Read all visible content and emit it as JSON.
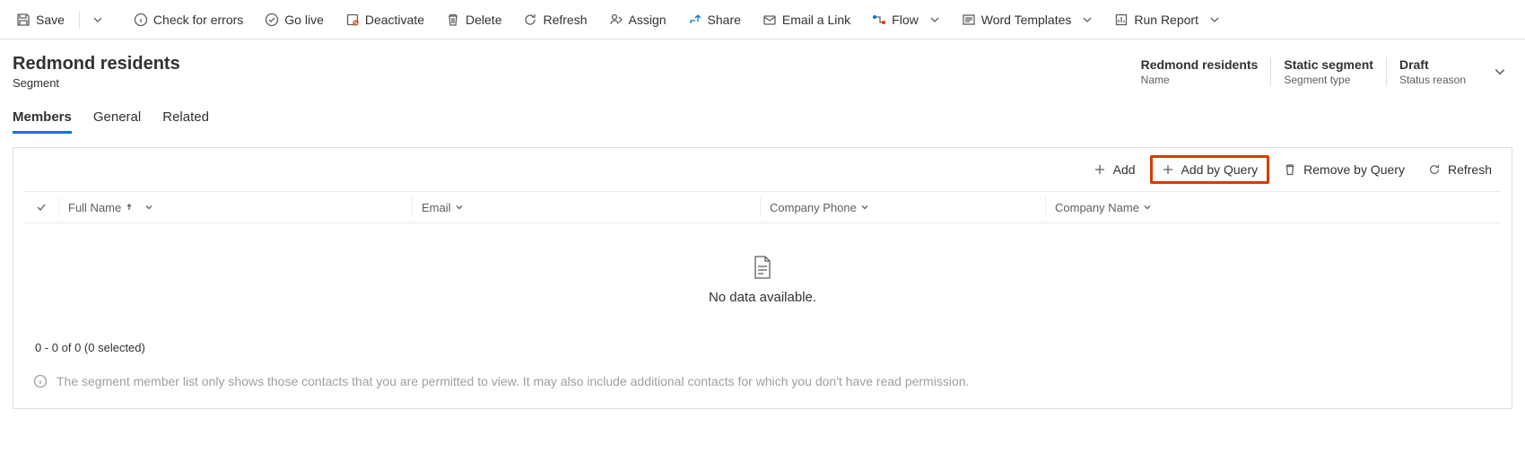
{
  "commandBar": {
    "save": "Save",
    "checkErrors": "Check for errors",
    "goLive": "Go live",
    "deactivate": "Deactivate",
    "delete": "Delete",
    "refresh": "Refresh",
    "assign": "Assign",
    "share": "Share",
    "emailLink": "Email a Link",
    "flow": "Flow",
    "wordTemplates": "Word Templates",
    "runReport": "Run Report"
  },
  "header": {
    "title": "Redmond residents",
    "subtitle": "Segment",
    "meta": [
      {
        "value": "Redmond residents",
        "label": "Name"
      },
      {
        "value": "Static segment",
        "label": "Segment type"
      },
      {
        "value": "Draft",
        "label": "Status reason"
      }
    ]
  },
  "tabs": {
    "members": "Members",
    "general": "General",
    "related": "Related"
  },
  "subBar": {
    "add": "Add",
    "addByQuery": "Add by Query",
    "removeByQuery": "Remove by Query",
    "refresh": "Refresh"
  },
  "columns": {
    "fullName": "Full Name",
    "email": "Email",
    "companyPhone": "Company Phone",
    "companyName": "Company Name"
  },
  "empty": {
    "message": "No data available."
  },
  "status": "0 - 0 of 0 (0 selected)",
  "info": "The segment member list only shows those contacts that you are permitted to view. It may also include additional contacts for which you don't have read permission."
}
